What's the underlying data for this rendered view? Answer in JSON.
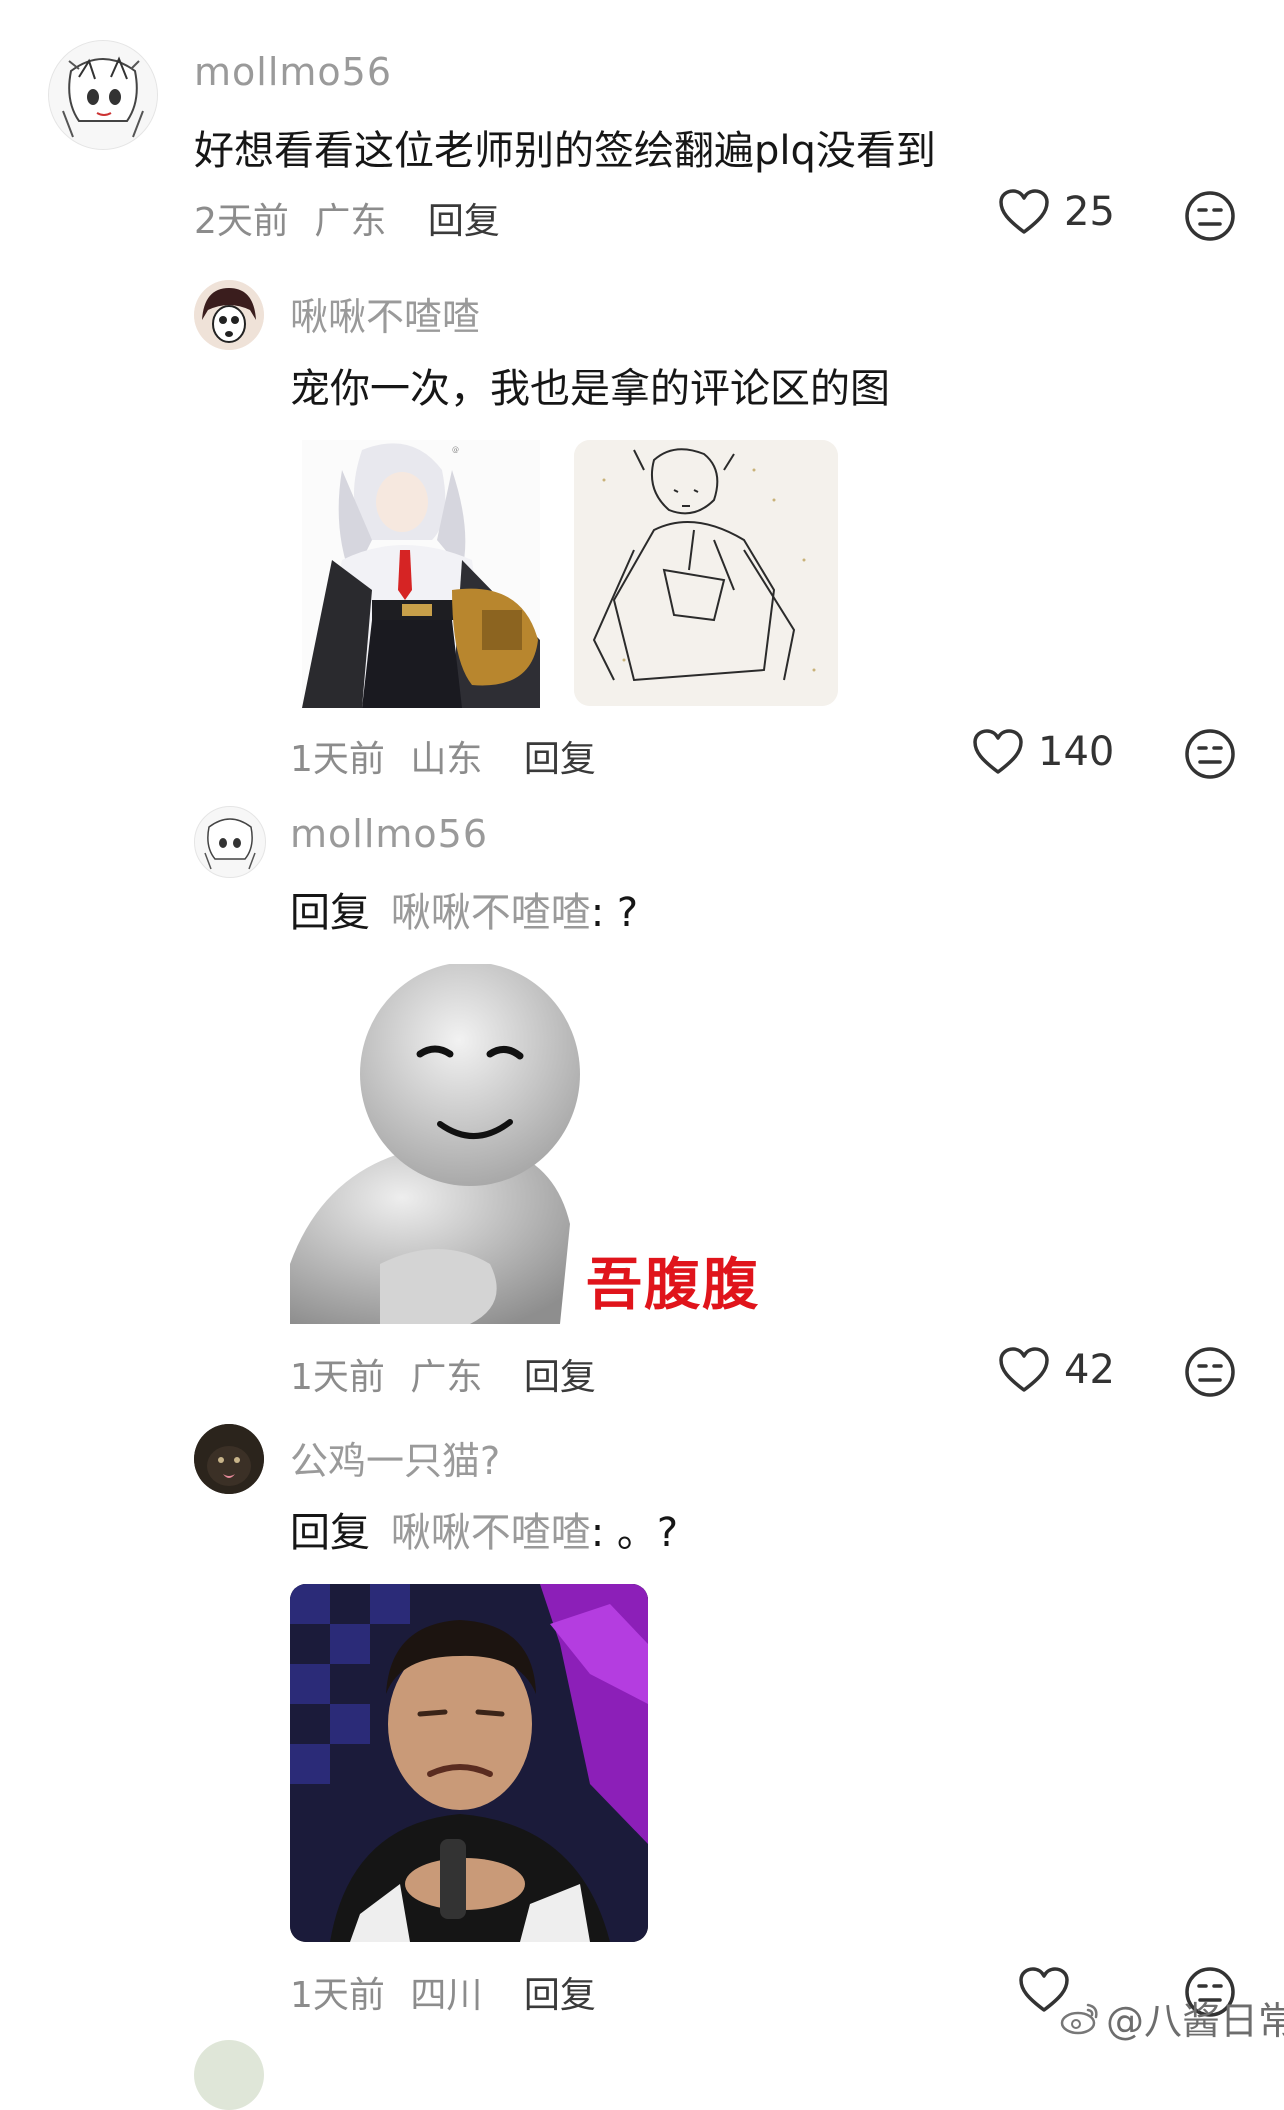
{
  "comment": {
    "username": "mollmo56",
    "text": "好想看看这位老师别的签绘翻遍plq没看到",
    "time": "2天前",
    "location": "广东",
    "reply_label": "回复",
    "likes": "25",
    "icons": {
      "like": "heart-outline-icon",
      "dislike": "neutral-face-icon"
    }
  },
  "replies": [
    {
      "username": "啾啾不喳喳",
      "text": "宠你一次，我也是拿的评论区的图",
      "time": "1天前",
      "location": "山东",
      "reply_label": "回复",
      "likes": "140"
    },
    {
      "username": "mollmo56",
      "reply_prefix": "回复",
      "reply_to": "啾啾不喳喳",
      "reply_text": ": ?",
      "sticker_caption": "吾腹腹",
      "time": "1天前",
      "location": "广东",
      "reply_label": "回复",
      "likes": "42"
    },
    {
      "username": "公鸡一只猫?",
      "reply_prefix": "回复",
      "reply_to": "啾啾不喳喳",
      "reply_text": ": 。?",
      "time": "1天前",
      "location": "四川",
      "reply_label": "回复",
      "likes": ""
    }
  ],
  "watermark": {
    "text": "@八酱日常",
    "icon": "weibo-icon"
  },
  "colors": {
    "caption_red": "#e0141b",
    "meta_gray": "#8c8c8c",
    "username_gray": "#9a9a9a"
  }
}
